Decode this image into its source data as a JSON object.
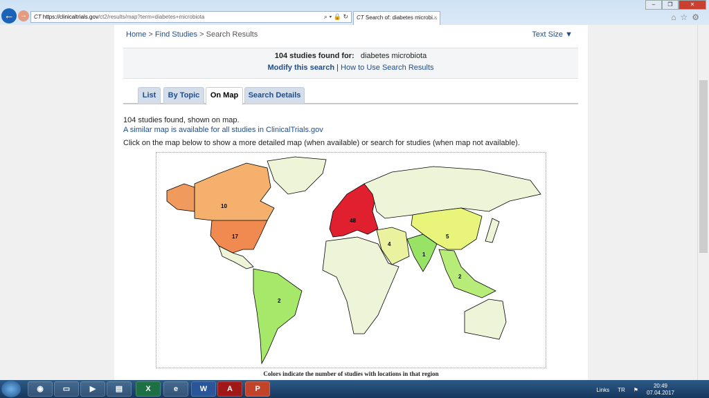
{
  "browser": {
    "url_domain": "https://clinicaltrials.gov",
    "url_path": "/ct2/results/map?term=diabetes+microbiota",
    "tab_title": "Search of: diabetes microbi...",
    "tab_icon": "CT"
  },
  "breadcrumb": {
    "home": "Home",
    "find": "Find Studies",
    "current": "Search Results",
    "sep": ">"
  },
  "text_size": "Text Size",
  "summary": {
    "count_label": "104 studies found for:",
    "query": "diabetes microbiota",
    "modify": "Modify this search",
    "sep": "|",
    "how_to": "How to Use Search Results"
  },
  "tabs": [
    {
      "label": "List"
    },
    {
      "label": "By Topic"
    },
    {
      "label": "On Map",
      "active": true
    },
    {
      "label": "Search Details"
    }
  ],
  "intro": {
    "line1": "104 studies found, shown on map.",
    "link": "A similar map is available for all studies in ClinicalTrials.gov",
    "line3": "Click on the map below to show a more detailed map (when available) or search for studies (when map not available)."
  },
  "map": {
    "regions": [
      {
        "name": "Canada",
        "count": "10",
        "color": "#f4b06c"
      },
      {
        "name": "United States",
        "count": "17",
        "color": "#f08a50"
      },
      {
        "name": "Europe",
        "count": "48",
        "color": "#e0202e"
      },
      {
        "name": "Middle East",
        "count": "4",
        "color": "#eaf2a0"
      },
      {
        "name": "India",
        "count": "1",
        "color": "#98e266"
      },
      {
        "name": "East Asia",
        "count": "5",
        "color": "#e8f47a"
      },
      {
        "name": "Southeast Asia",
        "count": "2",
        "color": "#b8ec78"
      },
      {
        "name": "South America",
        "count": "2",
        "color": "#a6e86a"
      }
    ],
    "empty_color": "#eef4d8",
    "caption": "Colors indicate the number of studies with locations in that region"
  },
  "taskbar": {
    "apps": [
      "Chrome",
      "Files",
      "Media",
      "Print",
      "Excel",
      "IE",
      "Word",
      "PDF",
      "PowerPoint"
    ],
    "links": "Links",
    "lang": "TR",
    "time": "20:49",
    "date": "07.04.2017"
  }
}
